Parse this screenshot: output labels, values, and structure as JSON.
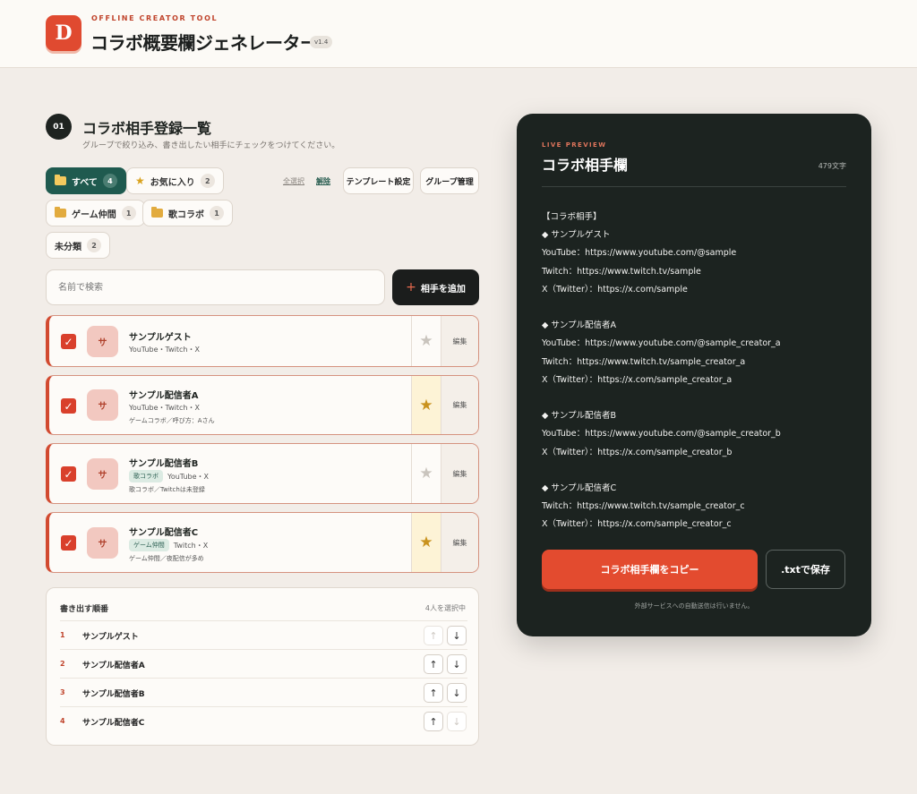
{
  "header": {
    "kicker": "OFFLINE CREATOR TOOL",
    "logo_letter": "D",
    "title": "コラボ概要欄ジェネレーター",
    "version": "v1.4"
  },
  "section": {
    "step": "01",
    "title": "コラボ相手登録一覧",
    "description": "グループで絞り込み、書き出したい相手にチェックをつけてください。"
  },
  "filters": [
    {
      "label": "すべて",
      "count": "4",
      "icon": "folder-icon"
    },
    {
      "label": "お気に入り",
      "count": "2",
      "icon": "star-icon"
    },
    {
      "label": "ゲーム仲間",
      "count": "1",
      "icon": "folder-icon"
    },
    {
      "label": "歌コラボ",
      "count": "1",
      "icon": "folder-icon"
    },
    {
      "label": "未分類",
      "count": "2"
    }
  ],
  "toolbar": {
    "select_all": "全選択",
    "clear": "解除",
    "template_settings": "テンプレート設定",
    "group_manage": "グループ管理"
  },
  "search": {
    "placeholder": "名前で検索"
  },
  "add_button": {
    "label": "相手を追加",
    "icon": "plus-icon"
  },
  "collaborators": [
    {
      "avatar": "サ",
      "name": "サンプルゲスト",
      "links": "YouTube・Twitch・X",
      "note": "",
      "tag": "",
      "favorite": false,
      "checked": true,
      "edit": "編集"
    },
    {
      "avatar": "サ",
      "name": "サンプル配信者A",
      "links": "YouTube・Twitch・X",
      "note": "ゲームコラボ／呼び方：Aさん",
      "tag": "",
      "favorite": true,
      "checked": true,
      "edit": "編集"
    },
    {
      "avatar": "サ",
      "name": "サンプル配信者B",
      "links": "YouTube・X",
      "note": "歌コラボ／Twitchは未登録",
      "tag": "歌コラボ",
      "favorite": false,
      "checked": true,
      "edit": "編集"
    },
    {
      "avatar": "サ",
      "name": "サンプル配信者C",
      "links": "Twitch・X",
      "note": "ゲーム仲間／夜配信が多め",
      "tag": "ゲーム仲間",
      "favorite": true,
      "checked": true,
      "edit": "編集"
    }
  ],
  "order": {
    "title": "書き出す順番",
    "selected_count": "4人を選択中",
    "rows": [
      {
        "index": "1",
        "name": "サンプルゲスト"
      },
      {
        "index": "2",
        "name": "サンプル配信者A"
      },
      {
        "index": "3",
        "name": "サンプル配信者B"
      },
      {
        "index": "4",
        "name": "サンプル配信者C"
      }
    ],
    "up": "↑",
    "down": "↓"
  },
  "preview": {
    "kicker": "LIVE PREVIEW",
    "title": "コラボ相手欄",
    "char_count": "479文字",
    "text": "【コラボ相手】\n◆ サンプルゲスト\nYouTube：https://www.youtube.com/@sample\nTwitch：https://www.twitch.tv/sample\nX（Twitter）：https://x.com/sample\n\n◆ サンプル配信者A\nYouTube：https://www.youtube.com/@sample_creator_a\nTwitch：https://www.twitch.tv/sample_creator_a\nX（Twitter）：https://x.com/sample_creator_a\n\n◆ サンプル配信者B\nYouTube：https://www.youtube.com/@sample_creator_b\nX（Twitter）：https://x.com/sample_creator_b\n\n◆ サンプル配信者C\nTwitch：https://www.twitch.tv/sample_creator_c\nX（Twitter）：https://x.com/sample_creator_c",
    "copy_button": "コラボ相手欄をコピー",
    "save_button": ".txtで保存",
    "note": "外部サービスへの自動送信は行いません。"
  }
}
